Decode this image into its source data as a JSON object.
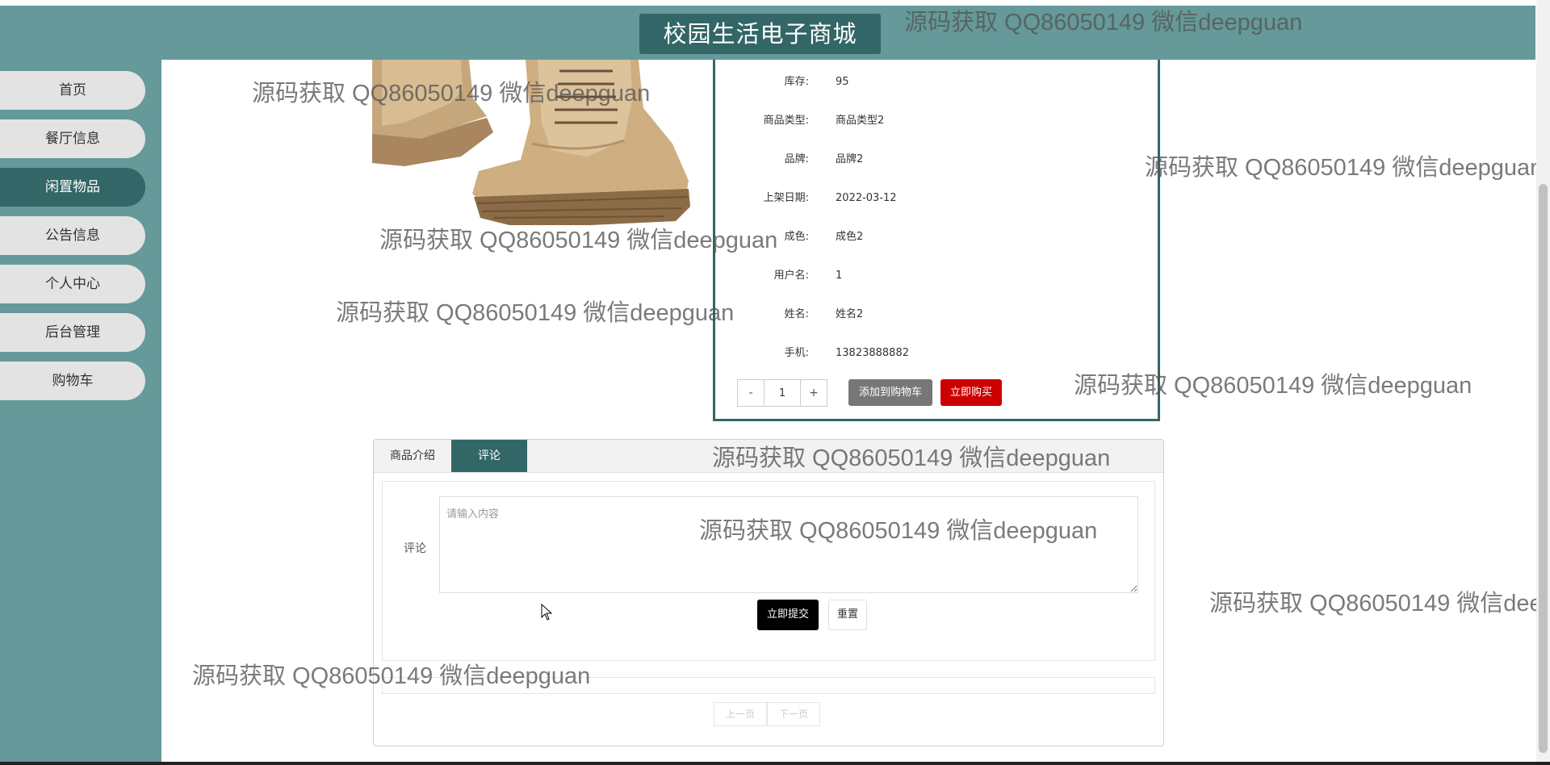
{
  "header": {
    "title": "校园生活电子商城"
  },
  "sidebar": {
    "items": [
      {
        "label": "首页",
        "active": false
      },
      {
        "label": "餐厅信息",
        "active": false
      },
      {
        "label": "闲置物品",
        "active": true
      },
      {
        "label": "公告信息",
        "active": false
      },
      {
        "label": "个人中心",
        "active": false
      },
      {
        "label": "后台管理",
        "active": false
      },
      {
        "label": "购物车",
        "active": false
      }
    ]
  },
  "product": {
    "image_icon": "boots-photo",
    "fields": [
      {
        "label": "库存:",
        "value": "95"
      },
      {
        "label": "商品类型:",
        "value": "商品类型2"
      },
      {
        "label": "品牌:",
        "value": "品牌2"
      },
      {
        "label": "上架日期:",
        "value": "2022-03-12"
      },
      {
        "label": "成色:",
        "value": "成色2"
      },
      {
        "label": "用户名:",
        "value": "1"
      },
      {
        "label": "姓名:",
        "value": "姓名2"
      },
      {
        "label": "手机:",
        "value": "13823888882"
      }
    ],
    "quantity": {
      "minus": "-",
      "value": "1",
      "plus": "+"
    },
    "add_to_cart_label": "添加到购物车",
    "buy_now_label": "立即购买"
  },
  "tabs": {
    "items": [
      {
        "label": "商品介绍",
        "active": false
      },
      {
        "label": "评论",
        "active": true
      }
    ]
  },
  "comment": {
    "label": "评论",
    "placeholder": "请输入内容",
    "value": "",
    "submit_label": "立即提交",
    "reset_label": "重置"
  },
  "pagination": {
    "prev_label": "上一页",
    "next_label": "下一页"
  },
  "watermark": {
    "text": "源码获取 QQ86050149 微信deepguan"
  },
  "colors": {
    "primary": "#669999",
    "primary_dark": "#336666",
    "buy": "#cc0000",
    "cart": "#777777",
    "submit": "#000000"
  }
}
